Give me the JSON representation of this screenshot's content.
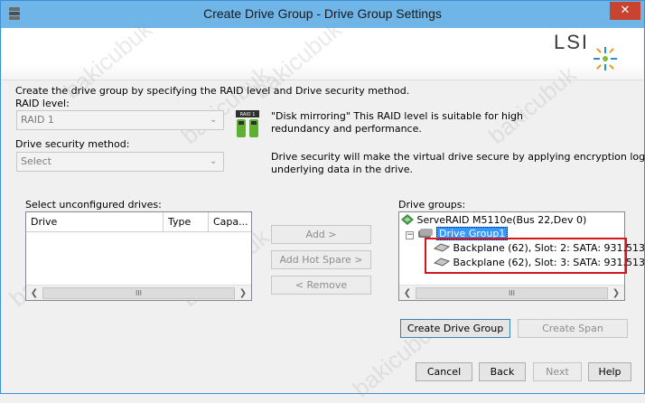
{
  "window": {
    "title": "Create Drive Group - Drive Group Settings",
    "close_label": "✕",
    "logo_text": "LSI"
  },
  "intro": "Create the drive group by specifying the RAID level and Drive security method.",
  "raid": {
    "label": "RAID level:",
    "value": "RAID 1",
    "icon_label": "RAID 1",
    "description_line1": "\"Disk mirroring\" This RAID level is suitable for high",
    "description_line2": "redundancy and performance."
  },
  "security": {
    "label": "Drive security method:",
    "value": "Select",
    "description_line1": "Drive security will make the virtual drive secure by applying encryption logic to",
    "description_line2": "underlying data in the drive."
  },
  "unconfigured": {
    "label": "Select unconfigured drives:",
    "columns": [
      "Drive",
      "Type",
      "Capa..."
    ]
  },
  "middle_buttons": {
    "add": "Add >",
    "add_hot_spare": "Add Hot Spare >",
    "remove": "< Remove"
  },
  "drive_groups": {
    "label": "Drive groups:",
    "controller": "ServeRAID M5110e(Bus 22,Dev 0)",
    "group": "Drive Group1",
    "drives": [
      "Backplane (62), Slot: 2: SATA: 931.513",
      "Backplane (62), Slot: 3: SATA: 931.513"
    ]
  },
  "group_buttons": {
    "create_drive_group": "Create Drive Group",
    "create_span": "Create Span"
  },
  "footer_buttons": {
    "cancel": "Cancel",
    "back": "Back",
    "next": "Next",
    "help": "Help"
  },
  "scroll_thumb": "III",
  "watermark": "bakicubuk",
  "colors": {
    "titlebar": "#6fb5e8",
    "close": "#c9442f",
    "selection": "#3399ff",
    "highlight_box": "#d4141e"
  }
}
